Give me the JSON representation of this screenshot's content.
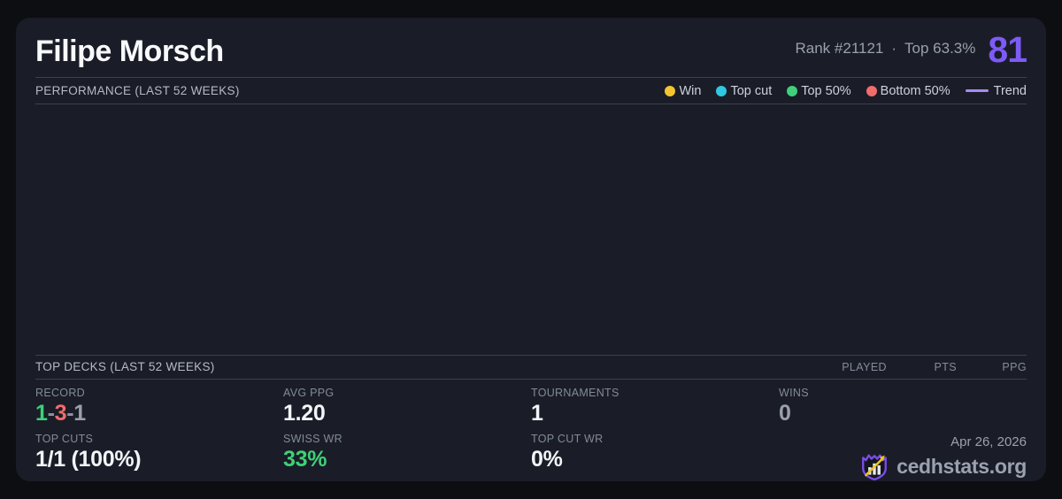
{
  "header": {
    "player_name": "Filipe Morsch",
    "rank_text": "Rank #21121",
    "separator": "·",
    "top_percent_text": "Top 63.3%",
    "score": "81"
  },
  "performance": {
    "section_title": "PERFORMANCE (LAST 52 WEEKS)",
    "legend": [
      {
        "label": "Win",
        "color": "#f2c531",
        "type": "dot"
      },
      {
        "label": "Top cut",
        "color": "#2fc8e0",
        "type": "dot"
      },
      {
        "label": "Top 50%",
        "color": "#41cf7c",
        "type": "dot"
      },
      {
        "label": "Bottom 50%",
        "color": "#f16c6c",
        "type": "dot"
      },
      {
        "label": "Trend",
        "color": "#a78bfa",
        "type": "line"
      }
    ],
    "chart_points": []
  },
  "top_decks": {
    "section_title": "TOP DECKS (LAST 52 WEEKS)",
    "columns": [
      "PLAYED",
      "PTS",
      "PPG"
    ],
    "rows": []
  },
  "stats": {
    "record": {
      "label": "RECORD",
      "wins": "1",
      "losses": "3",
      "draws": "1",
      "separator": "-"
    },
    "avg_ppg": {
      "label": "AVG PPG",
      "value": "1.20"
    },
    "tournaments": {
      "label": "TOURNAMENTS",
      "value": "1"
    },
    "wins": {
      "label": "WINS",
      "value": "0"
    },
    "top_cuts": {
      "label": "TOP CUTS",
      "value": "1/1 (100%)"
    },
    "swiss_wr": {
      "label": "SWISS WR",
      "value": "33%"
    },
    "top_cut_wr": {
      "label": "TOP CUT WR",
      "value": "0%"
    }
  },
  "footer": {
    "date": "Apr 26, 2026",
    "brand": "cedhstats.org"
  },
  "colors": {
    "page_background": "#0d0e12",
    "card_background": "#1a1d27",
    "accent_purple": "#7d5bf7",
    "trend_purple": "#a78bfa",
    "win_yellow": "#f2c531",
    "topcut_cyan": "#2fc8e0",
    "green": "#3ed178",
    "red": "#f16c6c",
    "muted_gray": "#99a0ac"
  }
}
